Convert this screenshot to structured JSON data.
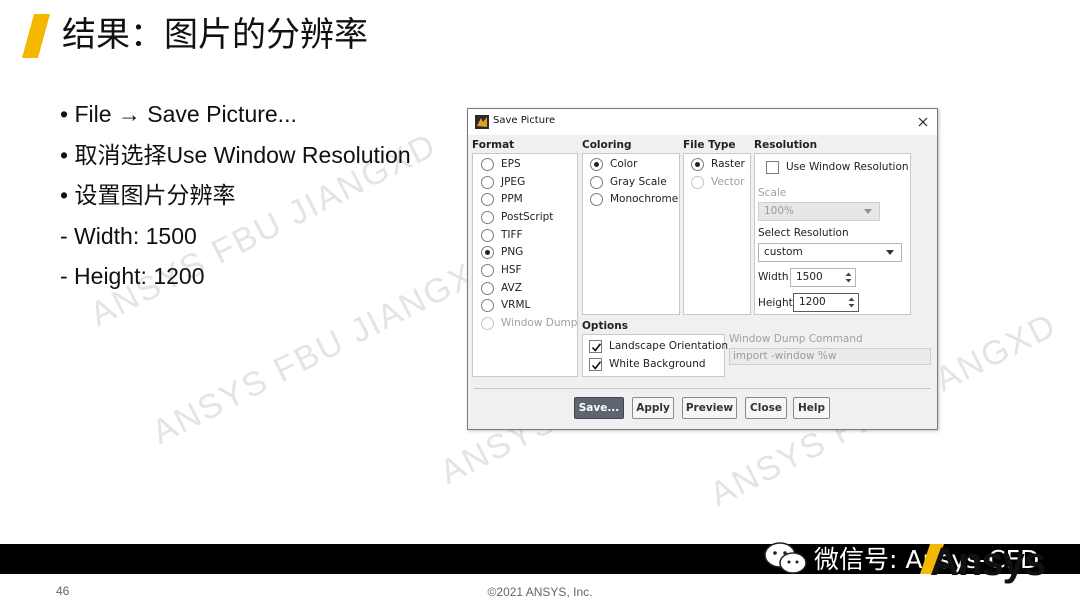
{
  "slide": {
    "title": "结果：图片的分辨率",
    "accent_color": "#f5b800",
    "bullets": [
      "• File → Save Picture...",
      "• 取消选择Use Window Resolution",
      "• 设置图片分辨率",
      "- Width: 1500",
      "- Height: 1200"
    ],
    "watermark": "ANSYS FBU JIANGXD",
    "page_number": "46",
    "copyright": "©2021 ANSYS, Inc.",
    "wechat_text": "微信号: Ansys-CFD",
    "logo_text": "Ansys"
  },
  "dialog": {
    "title": "Save Picture",
    "format": {
      "label": "Format",
      "options": [
        "EPS",
        "JPEG",
        "PPM",
        "PostScript",
        "TIFF",
        "PNG",
        "HSF",
        "AVZ",
        "VRML",
        "Window Dump"
      ],
      "selected": "PNG",
      "disabled": [
        "Window Dump"
      ]
    },
    "coloring": {
      "label": "Coloring",
      "options": [
        "Color",
        "Gray Scale",
        "Monochrome"
      ],
      "selected": "Color"
    },
    "file_type": {
      "label": "File Type",
      "options": [
        "Raster",
        "Vector"
      ],
      "selected": "Raster",
      "disabled": [
        "Vector"
      ]
    },
    "resolution": {
      "label": "Resolution",
      "use_window_resolution_label": "Use Window Resolution",
      "use_window_resolution_checked": false,
      "scale_label": "Scale",
      "scale_value": "100%",
      "select_resolution_label": "Select Resolution",
      "select_resolution_value": "custom",
      "width_label": "Width",
      "width_value": "1500",
      "height_label": "Height",
      "height_value": "1200"
    },
    "options": {
      "label": "Options",
      "landscape_label": "Landscape Orientation",
      "landscape_checked": true,
      "white_bg_label": "White Background",
      "white_bg_checked": true
    },
    "window_dump": {
      "label": "Window Dump Command",
      "value": "import -window %w"
    },
    "buttons": {
      "save": "Save...",
      "apply": "Apply",
      "preview": "Preview",
      "close": "Close",
      "help": "Help"
    }
  }
}
